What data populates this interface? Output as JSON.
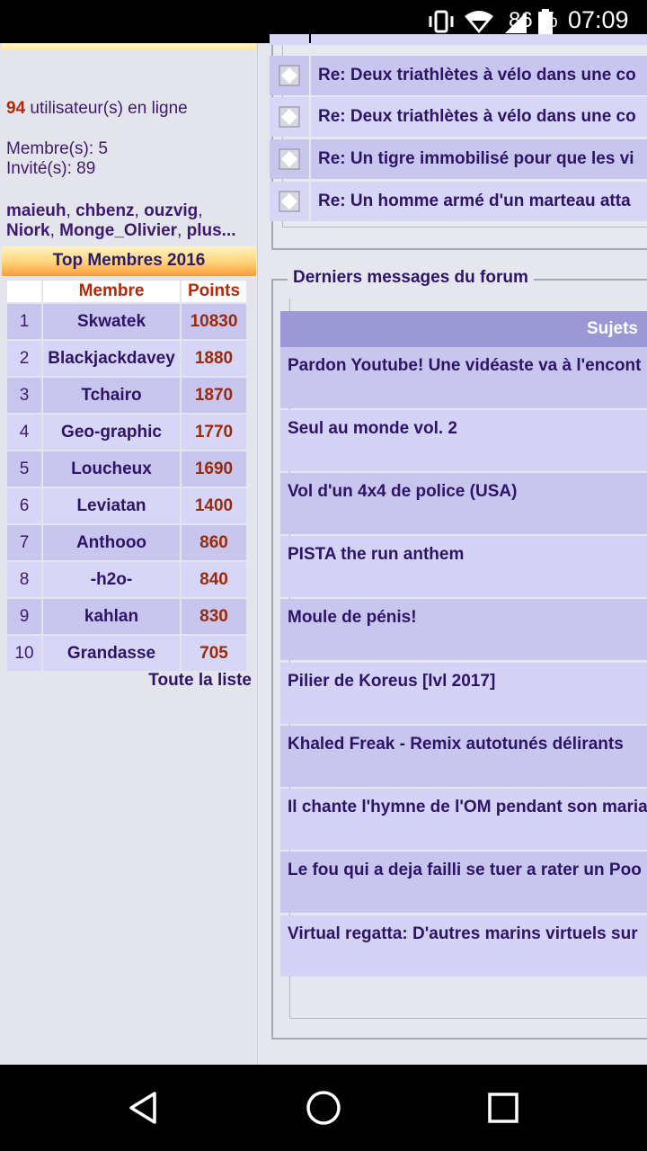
{
  "status_bar": {
    "battery_percent": "86 %",
    "time": "07:09"
  },
  "sidebar": {
    "online_count": "94",
    "online_suffix": "utilisateur(s) en ligne",
    "members": "Membre(s): 5",
    "guests": "Invité(s): 89",
    "online_users": [
      "maieuh",
      "chbenz",
      "ouzvig",
      "Niork",
      "Monge_Olivier",
      "plus..."
    ],
    "top_title": "Top Membres 2016",
    "columns": [
      "",
      "Membre",
      "Points"
    ],
    "ranking": [
      {
        "rank": "1",
        "name": "Skwatek",
        "points": "10830"
      },
      {
        "rank": "2",
        "name": "Blackjackdavey",
        "points": "1880"
      },
      {
        "rank": "3",
        "name": "Tchairo",
        "points": "1870"
      },
      {
        "rank": "4",
        "name": "Geo-graphic",
        "points": "1770"
      },
      {
        "rank": "5",
        "name": "Loucheux",
        "points": "1690"
      },
      {
        "rank": "6",
        "name": "Leviatan",
        "points": "1400"
      },
      {
        "rank": "7",
        "name": "Anthooo",
        "points": "860"
      },
      {
        "rank": "8",
        "name": "-h2o-",
        "points": "840"
      },
      {
        "rank": "9",
        "name": "kahlan",
        "points": "830"
      },
      {
        "rank": "10",
        "name": "Grandasse",
        "points": "705"
      }
    ],
    "full_list_label": "Toute la liste"
  },
  "recent_comments": [
    "Re: Deux triathlètes à vélo dans une co",
    "Re: Deux triathlètes à vélo dans une co",
    "Re: Un tigre immobilisé pour que les vi",
    "Re: Un homme armé d'un marteau atta"
  ],
  "forum": {
    "legend": "Derniers messages du forum",
    "header": "Sujets",
    "topics": [
      "Pardon Youtube! Une vidéaste va à l'encont",
      "Seul au monde vol. 2",
      "Vol d'un 4x4 de police (USA)",
      "PISTA the run anthem",
      "Moule de pénis!",
      "Pilier de Koreus [lvl 2017]",
      "Khaled Freak - Remix autotunés délirants",
      "Il chante l'hymne de l'OM pendant son maria",
      "Le fou qui a deja failli se tuer a rater un Poo",
      "Virtual regatta: D'autres marins virtuels sur"
    ]
  }
}
